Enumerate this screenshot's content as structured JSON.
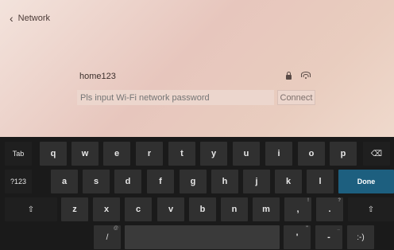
{
  "header": {
    "back_label": "Network"
  },
  "network": {
    "ssid": "home123"
  },
  "password": {
    "placeholder": "Pls input Wi-Fi network password",
    "value": ""
  },
  "connect_label": "Connect",
  "keyboard": {
    "row1": [
      "Tab",
      "q",
      "w",
      "e",
      "r",
      "t",
      "y",
      "u",
      "i",
      "o",
      "p",
      "⌫"
    ],
    "row2": [
      "?123",
      "a",
      "s",
      "d",
      "f",
      "g",
      "h",
      "j",
      "k",
      "l",
      "Done"
    ],
    "row3": [
      "⇧",
      "z",
      "x",
      "c",
      "v",
      "b",
      "n",
      "m",
      ",",
      ".",
      "⇧"
    ],
    "row4": [
      "",
      "/",
      "",
      "'",
      "-",
      ":-)"
    ],
    "hints": {
      "slash": "@",
      "comma": "!",
      "period": "?",
      "apostrophe": "\"",
      "dash": "_"
    }
  }
}
